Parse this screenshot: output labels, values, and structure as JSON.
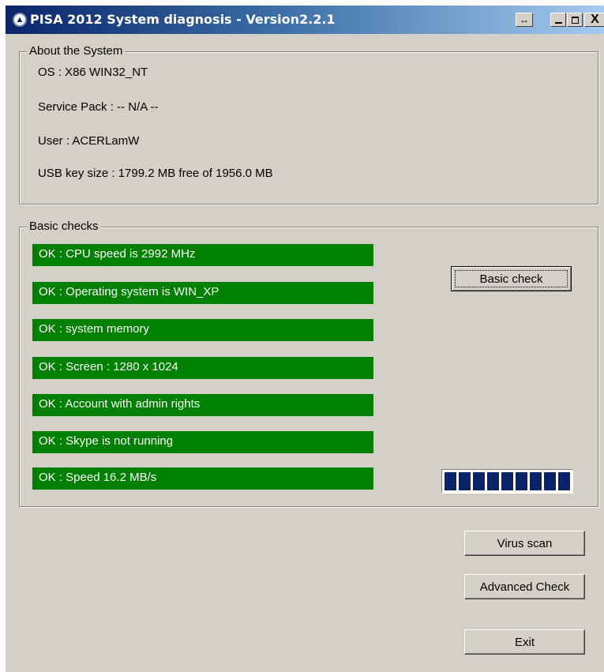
{
  "window": {
    "title": "PISA 2012 System diagnosis - Version2.2.1",
    "controls": {
      "resize_glyph": "↔",
      "close_glyph": "X"
    }
  },
  "about": {
    "legend": "About the System",
    "os": "OS  : X86 WIN32_NT",
    "service_pack": "Service Pack   : -- N/A --",
    "user": "User : ACERLamW",
    "usb": "USB key size : 1799.2 MB free of 1956.0 MB"
  },
  "basic": {
    "legend": "Basic checks",
    "results": [
      "OK :  CPU speed is 2992 MHz",
      "OK :  Operating system is WIN_XP",
      "OK :  system memory",
      "OK :  Screen : 1280 x 1024",
      "OK : Account with admin rights",
      "OK : Skype is not running",
      "OK :  Speed 16.2 MB/s"
    ],
    "status_color": "#008000",
    "basic_check_label": "Basic check",
    "progress": {
      "segments_filled": 9,
      "segments_total": 9,
      "percent": 100,
      "color": "#0a246a"
    }
  },
  "actions": {
    "virus_scan": "Virus scan",
    "advanced_check": "Advanced Check",
    "exit": "Exit"
  }
}
